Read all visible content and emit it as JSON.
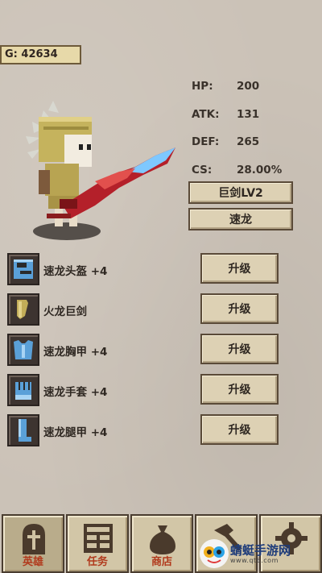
{
  "gold": "G: 42634",
  "stats": [
    {
      "key": "HP:",
      "value": "200"
    },
    {
      "key": "ATK:",
      "value": "131"
    },
    {
      "key": "DEF:",
      "value": "265"
    },
    {
      "key": "CS:",
      "value": "28.00%"
    }
  ],
  "weapon_button": "巨剑LV2",
  "class_button": "速龙",
  "equipment": [
    {
      "name": "速龙头盔 +4",
      "icon": "helmet-icon",
      "upgrade": "升级"
    },
    {
      "name": "火龙巨剑",
      "icon": "sword-icon",
      "upgrade": "升级"
    },
    {
      "name": "速龙胸甲 +4",
      "icon": "chestplate-icon",
      "upgrade": "升级"
    },
    {
      "name": "速龙手套 +4",
      "icon": "gauntlet-icon",
      "upgrade": "升级"
    },
    {
      "name": "速龙腿甲 +4",
      "icon": "greaves-icon",
      "upgrade": "升级"
    }
  ],
  "nav": [
    {
      "label": "英雄",
      "icon": "helmet-icon"
    },
    {
      "label": "任务",
      "icon": "list-icon"
    },
    {
      "label": "商店",
      "icon": "bag-icon"
    },
    {
      "label": "",
      "icon": "hammer-icon"
    },
    {
      "label": "",
      "icon": "gear-icon"
    }
  ],
  "watermark": {
    "text": "蜻蜓手游网",
    "url": "www.qt6.com"
  },
  "colors": {
    "background": "#cbc2b7",
    "button": "#ddd1b4",
    "label_red": "#b13a1d"
  }
}
